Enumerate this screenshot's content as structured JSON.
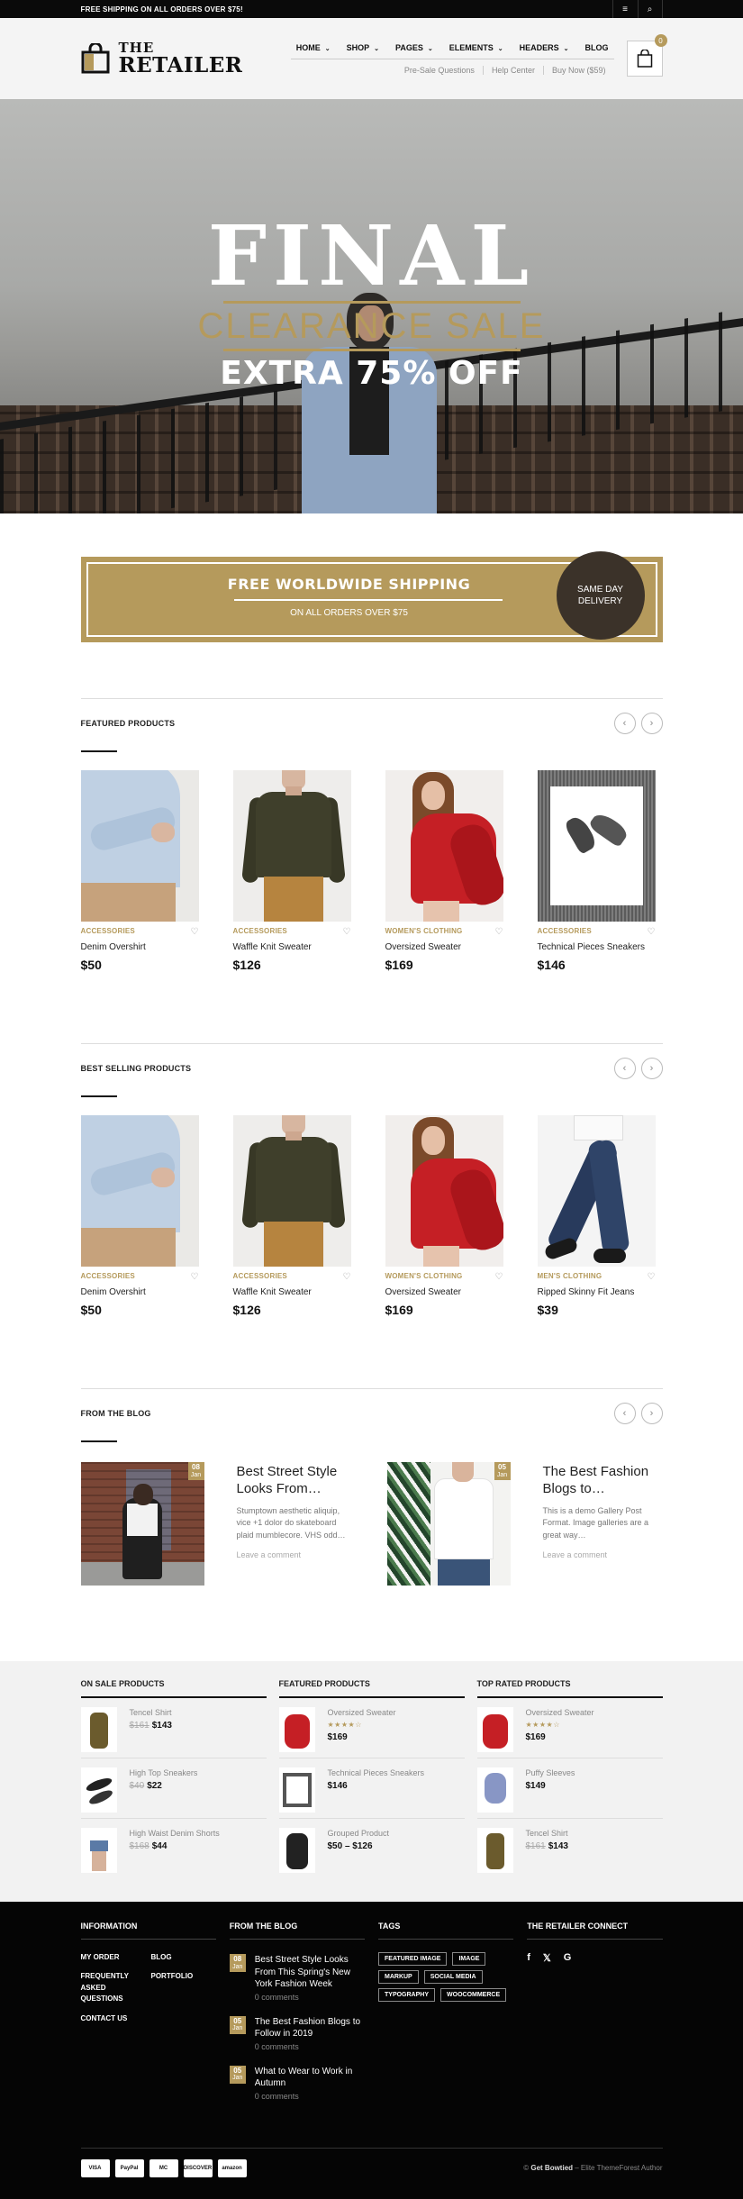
{
  "topbar": {
    "text": "FREE SHIPPING ON ALL ORDERS OVER $75!",
    "menu_icon": "menu-icon",
    "search_icon": "search-icon"
  },
  "logo": {
    "line1": "THE",
    "line2": "RETAILER"
  },
  "nav": {
    "items": [
      {
        "label": "HOME",
        "dropdown": true
      },
      {
        "label": "SHOP",
        "dropdown": true
      },
      {
        "label": "PAGES",
        "dropdown": true
      },
      {
        "label": "ELEMENTS",
        "dropdown": true
      },
      {
        "label": "HEADERS",
        "dropdown": true
      },
      {
        "label": "BLOG",
        "dropdown": false
      }
    ],
    "sub_items": [
      "Pre-Sale Questions",
      "Help Center",
      "Buy Now ($59)"
    ],
    "cart_count": "0"
  },
  "hero": {
    "title": "FINAL",
    "subtitle": "CLEARANCE SALE",
    "offer": "EXTRA 75% OFF"
  },
  "shipping": {
    "title": "FREE WORLDWIDE SHIPPING",
    "subtitle": "ON ALL ORDERS OVER $75",
    "badge_line1": "SAME DAY",
    "badge_line2": "DELIVERY"
  },
  "featured": {
    "title": "FEATURED PRODUCTS",
    "products": [
      {
        "category": "ACCESSORIES",
        "name": "Denim Overshirt",
        "price": "$50"
      },
      {
        "category": "ACCESSORIES",
        "name": "Waffle Knit Sweater",
        "price": "$126"
      },
      {
        "category": "WOMEN'S CLOTHING",
        "name": "Oversized Sweater",
        "price": "$169"
      },
      {
        "category": "ACCESSORIES",
        "name": "Technical Pieces Sneakers",
        "price": "$146"
      }
    ]
  },
  "best_selling": {
    "title": "BEST SELLING PRODUCTS",
    "products": [
      {
        "category": "ACCESSORIES",
        "name": "Denim Overshirt",
        "price": "$50"
      },
      {
        "category": "ACCESSORIES",
        "name": "Waffle Knit Sweater",
        "price": "$126"
      },
      {
        "category": "WOMEN'S CLOTHING",
        "name": "Oversized Sweater",
        "price": "$169"
      },
      {
        "category": "MEN'S CLOTHING",
        "name": "Ripped Skinny Fit Jeans",
        "price": "$39"
      }
    ]
  },
  "blog": {
    "title": "FROM THE BLOG",
    "posts": [
      {
        "day": "08",
        "month": "Jan",
        "title": "Best Street Style Looks From…",
        "excerpt": "Stumptown aesthetic aliquip, vice +1 dolor do skateboard plaid mumblecore. VHS odd…",
        "comment": "Leave a comment"
      },
      {
        "day": "05",
        "month": "Jan",
        "title": "The Best Fashion Blogs to…",
        "excerpt": "This is a demo Gallery Post Format. Image galleries are a great way…",
        "comment": "Leave a comment"
      }
    ]
  },
  "widgets": {
    "on_sale": {
      "title": "ON SALE PRODUCTS",
      "items": [
        {
          "name": "Tencel Shirt",
          "old": "$161",
          "price": "$143"
        },
        {
          "name": "High Top Sneakers",
          "old": "$40",
          "price": "$22"
        },
        {
          "name": "High Waist Denim Shorts",
          "old": "$168",
          "price": "$44"
        }
      ]
    },
    "featured": {
      "title": "FEATURED PRODUCTS",
      "items": [
        {
          "name": "Oversized Sweater",
          "stars": "★★★★☆",
          "price": "$169"
        },
        {
          "name": "Technical Pieces Sneakers",
          "price": "$146"
        },
        {
          "name": "Grouped Product",
          "price": "$50 – $126"
        }
      ]
    },
    "top_rated": {
      "title": "TOP RATED PRODUCTS",
      "items": [
        {
          "name": "Oversized Sweater",
          "stars": "★★★★☆",
          "price": "$169"
        },
        {
          "name": "Puffy Sleeves",
          "price": "$149"
        },
        {
          "name": "Tencel Shirt",
          "old": "$161",
          "price": "$143"
        }
      ]
    }
  },
  "footer": {
    "information": {
      "title": "INFORMATION",
      "col1": [
        "MY ORDER",
        "FREQUENTLY ASKED QUESTIONS",
        "CONTACT US"
      ],
      "col2": [
        "BLOG",
        "PORTFOLIO"
      ]
    },
    "blog": {
      "title": "FROM THE BLOG",
      "posts": [
        {
          "day": "08",
          "month": "Jan",
          "title": "Best Street Style Looks From This Spring's New York Fashion Week",
          "comments": "0 comments"
        },
        {
          "day": "05",
          "month": "Jan",
          "title": "The Best Fashion Blogs to Follow in 2019",
          "comments": "0 comments"
        },
        {
          "day": "05",
          "month": "Jan",
          "title": "What to Wear to Work in Autumn",
          "comments": "0 comments"
        }
      ]
    },
    "tags": {
      "title": "TAGS",
      "items": [
        "FEATURED IMAGE",
        "IMAGE",
        "MARKUP",
        "SOCIAL MEDIA",
        "TYPOGRAPHY",
        "WOOCOMMERCE"
      ]
    },
    "connect": {
      "title": "THE RETAILER CONNECT",
      "icons": [
        "f",
        "𝕏",
        "G"
      ]
    },
    "payments": [
      "VISA",
      "PayPal",
      "MC",
      "DISCOVER",
      "amazon"
    ],
    "copyright_pre": "© ",
    "copyright_brand": "Get Bowtied",
    "copyright_post": " – Elite ThemeForest Author"
  },
  "colors": {
    "accent": "#b59a5c",
    "dark": "#0a0a0a"
  }
}
